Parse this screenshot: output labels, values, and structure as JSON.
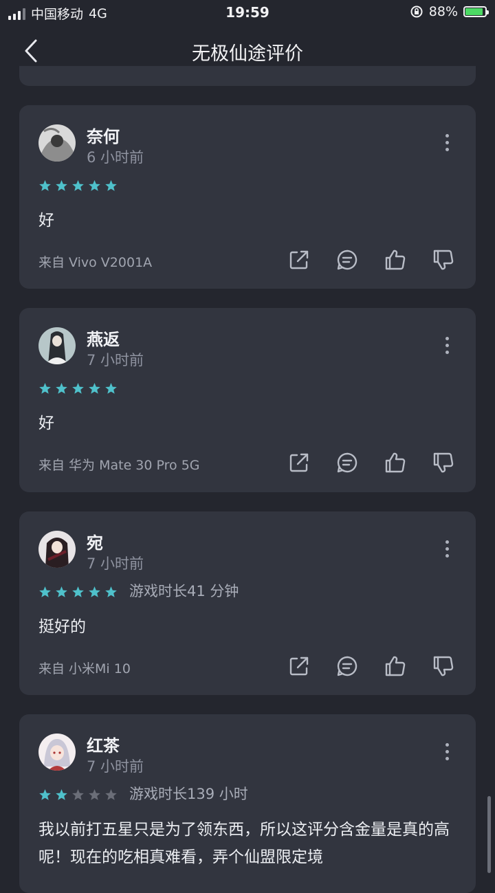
{
  "status_bar": {
    "carrier": "中国移动",
    "network": "4G",
    "time": "19:59",
    "battery": "88%",
    "battery_level": 0.88
  },
  "header": {
    "title": "无极仙途评价"
  },
  "colors": {
    "background": "#24262e",
    "card": "#32353f",
    "star_on": "#4fc1cb",
    "star_off": "#6b6e78"
  },
  "reviews": [
    {
      "username": "奈何",
      "time": "6 小时前",
      "rating": 5,
      "playtime": "",
      "text": "好",
      "device": "来自 Vivo V2001A"
    },
    {
      "username": "燕返",
      "time": "7 小时前",
      "rating": 5,
      "playtime": "",
      "text": "好",
      "device": "来自 华为 Mate 30 Pro 5G"
    },
    {
      "username": "宛",
      "time": "7 小时前",
      "rating": 5,
      "playtime": "游戏时长41 分钟",
      "text": "挺好的",
      "device": "来自 小米Mi 10"
    },
    {
      "username": "红茶",
      "time": "7 小时前",
      "rating": 2,
      "playtime": "游戏时长139 小时",
      "text": "我以前打五星只是为了领东西，所以这评分含金量是真的高呢！现在的吃相真难看，弄个仙盟限定境",
      "device": ""
    }
  ],
  "icons": [
    "back-arrow-icon",
    "more-icon",
    "share-icon",
    "comment-icon",
    "thumbs-up-icon",
    "thumbs-down-icon",
    "star-icon"
  ]
}
